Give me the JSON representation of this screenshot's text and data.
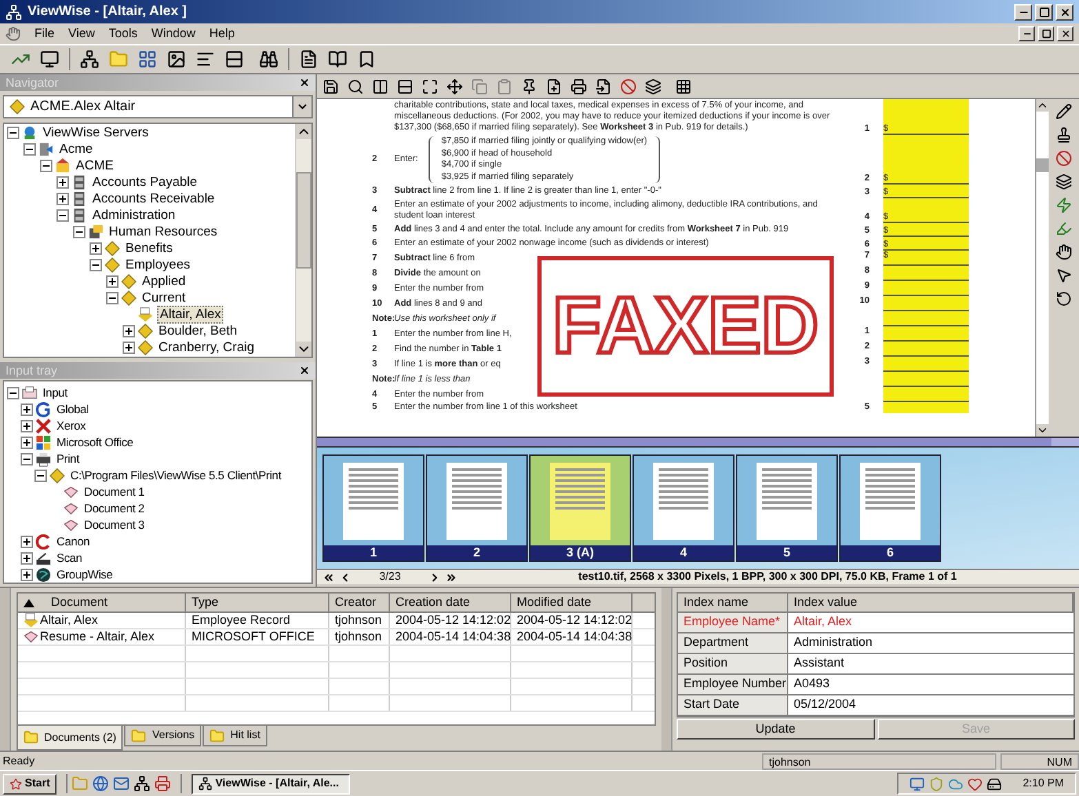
{
  "window": {
    "title": "ViewWise - [Altair, Alex ]"
  },
  "menu": [
    "File",
    "View",
    "Tools",
    "Window",
    "Help"
  ],
  "navigator": {
    "title": "Navigator",
    "selector": "ACME.Alex Altair",
    "tree": [
      {
        "label": "ViewWise Servers",
        "kind": "servers",
        "expanded": true,
        "selected": false,
        "children": [
          {
            "label": "Acme",
            "kind": "server",
            "expanded": true,
            "selected": false,
            "children": [
              {
                "label": "ACME",
                "kind": "site",
                "expanded": true,
                "selected": false,
                "children": [
                  {
                    "label": "Accounts Payable",
                    "kind": "cabinet",
                    "expanded": false,
                    "selected": false
                  },
                  {
                    "label": "Accounts Receivable",
                    "kind": "cabinet",
                    "expanded": false,
                    "selected": false
                  },
                  {
                    "label": "Administration",
                    "kind": "cabinet",
                    "expanded": true,
                    "selected": false,
                    "children": [
                      {
                        "label": "Human Resources",
                        "kind": "drawer",
                        "expanded": true,
                        "selected": false,
                        "children": [
                          {
                            "label": "Benefits",
                            "kind": "diamond",
                            "expanded": false,
                            "selected": false
                          },
                          {
                            "label": "Employees",
                            "kind": "diamond",
                            "expanded": true,
                            "selected": false,
                            "children": [
                              {
                                "label": "Applied",
                                "kind": "diamond",
                                "expanded": false,
                                "selected": false
                              },
                              {
                                "label": "Current",
                                "kind": "diamond",
                                "expanded": true,
                                "selected": false,
                                "children": [
                                  {
                                    "label": "Altair, Alex",
                                    "kind": "record",
                                    "selected": true
                                  },
                                  {
                                    "label": "Boulder, Beth",
                                    "kind": "diamond",
                                    "expanded": false,
                                    "selected": false
                                  },
                                  {
                                    "label": "Cranberry, Craig",
                                    "kind": "diamond",
                                    "expanded": false,
                                    "selected": false
                                  }
                                ]
                              }
                            ]
                          }
                        ]
                      }
                    ]
                  }
                ]
              }
            ]
          }
        ]
      }
    ]
  },
  "input_tray": {
    "title": "Input tray",
    "tree": [
      {
        "label": "Input",
        "kind": "tray",
        "expanded": true,
        "selected": false,
        "children": [
          {
            "label": "Global",
            "kind": "global",
            "expanded": false,
            "selected": false
          },
          {
            "label": "Xerox",
            "kind": "xerox",
            "expanded": false,
            "selected": false
          },
          {
            "label": "Microsoft Office",
            "kind": "office",
            "expanded": false,
            "selected": false
          },
          {
            "label": "Print",
            "kind": "printer",
            "expanded": true,
            "selected": false,
            "children": [
              {
                "label": "C:\\Program Files\\ViewWise 5.5 Client\\Print",
                "kind": "diamond",
                "expanded": true,
                "selected": false,
                "children": [
                  {
                    "label": "Document 1",
                    "kind": "document",
                    "selected": false
                  },
                  {
                    "label": "Document 2",
                    "kind": "document",
                    "selected": false
                  },
                  {
                    "label": "Document 3",
                    "kind": "document",
                    "selected": false
                  }
                ]
              }
            ]
          },
          {
            "label": "Canon",
            "kind": "canon",
            "expanded": false,
            "selected": false
          },
          {
            "label": "Scan",
            "kind": "scanner",
            "expanded": false,
            "selected": false
          },
          {
            "label": "GroupWise",
            "kind": "groupwise",
            "expanded": false,
            "selected": false
          }
        ]
      }
    ]
  },
  "form": {
    "lines": [
      {
        "kind": "text",
        "text": "charitable contributions, state and local taxes, medical expenses in excess of 7.5% of your income, and miscellaneous deductions. (For 2002, you may have to reduce your itemized deductions if your income is over $137,300 ($68,650 if married filing separately). See **Worksheet 3** in Pub. 919 for details.)",
        "ref": "1",
        "amount": "$"
      },
      {
        "kind": "choice",
        "number": "2",
        "text": "Enter:",
        "options": [
          "$7,850 if married filing jointly or qualifying widow(er)",
          "$6,900 if head of household",
          "$4,700 if single",
          "$3,925 if married filing separately"
        ],
        "ref": "2",
        "amount": "$"
      },
      {
        "kind": "text",
        "number": "3",
        "text": "**Subtract** line 2 from line 1. If line 2 is greater than line 1, enter \"-0-\"",
        "ref": "3",
        "amount": "$"
      },
      {
        "kind": "text",
        "number": "4",
        "text": "Enter an estimate of your 2002 adjustments to income, including alimony, deductible IRA contributions, and student loan interest",
        "ref": "4",
        "amount": "$"
      },
      {
        "kind": "text",
        "number": "5",
        "text": "**Add** lines 3 and 4 and enter the total. Include any amount for credits from **Worksheet 7** in Pub. 919",
        "ref": "5",
        "amount": "$"
      },
      {
        "kind": "text",
        "number": "6",
        "text": "Enter an estimate of your 2002 nonwage income (such as dividends or interest)",
        "ref": "6",
        "amount": "$"
      }
    ],
    "stamp": {
      "text": "FAXED",
      "fragments": [
        {
          "number": "7",
          "text": "**Subtract** line 6 from",
          "ref": "7",
          "amount": "$"
        },
        {
          "number": "8",
          "text": "**Divide** the amount on",
          "ref": "8"
        },
        {
          "number": "9",
          "text": "Enter the number from",
          "ref": "9"
        },
        {
          "number": "10",
          "text": "**Add** lines 8 and 9 and",
          "ref": "10"
        },
        {
          "number": "Note:",
          "text": "*Use this worksheet only if*"
        },
        {
          "number": "1",
          "text": "Enter the number from line H,",
          "ref": "1"
        },
        {
          "number": "2",
          "text": "Find the number in **Table 1**",
          "ref": "2"
        },
        {
          "number": "3",
          "text": "If line 1 is **more than** or eq",
          "ref": "3"
        },
        {
          "number": "Note:",
          "text": "*If line 1 is less than*"
        },
        {
          "number": "4",
          "text": "Enter the number from"
        }
      ]
    },
    "footer": {
      "number": "5",
      "text": "Enter the number from line 1 of this worksheet",
      "ref": "5"
    }
  },
  "thumbnails": [
    {
      "label": "1",
      "selected": false
    },
    {
      "label": "2",
      "selected": false
    },
    {
      "label": "3 (A)",
      "selected": true
    },
    {
      "label": "4",
      "selected": false
    },
    {
      "label": "5",
      "selected": false
    },
    {
      "label": "6",
      "selected": false
    }
  ],
  "page_nav": {
    "position": "3/23",
    "file_info": "test10.tif, 2568 x 3300 Pixels, 1 BPP, 300 x 300 DPI, 75.0 KB, Frame 1 of 1"
  },
  "documents_table": {
    "columns": [
      {
        "label": "Document",
        "sorted": true
      },
      {
        "label": "Type",
        "sorted": false
      },
      {
        "label": "Creator",
        "sorted": false
      },
      {
        "label": "Creation date",
        "sorted": false
      },
      {
        "label": "Modified date",
        "sorted": false
      }
    ],
    "rows": [
      {
        "kind": "record",
        "cells": [
          "Altair, Alex",
          "Employee Record",
          "tjohnson",
          "2004-05-12 14:12:02",
          "2004-05-12 14:12:02"
        ]
      },
      {
        "kind": "document",
        "cells": [
          "Resume - Altair, Alex",
          "MICROSOFT OFFICE",
          "tjohnson",
          "2004-05-14 14:04:38",
          "2004-05-14 14:04:38"
        ]
      }
    ]
  },
  "bottom_tabs": [
    {
      "label": "Documents (2)",
      "selected": true
    },
    {
      "label": "Versions",
      "selected": false
    },
    {
      "label": "Hit list",
      "selected": false
    }
  ],
  "index_table": {
    "columns": [
      "Index name",
      "Index value"
    ],
    "rows": [
      {
        "name": "Employee Name*",
        "value": "Altair, Alex",
        "flagged": true
      },
      {
        "name": "Department",
        "value": "Administration",
        "flagged": false
      },
      {
        "name": "Position",
        "value": "Assistant",
        "flagged": false
      },
      {
        "name": "Employee Number",
        "value": "A0493",
        "flagged": false
      },
      {
        "name": "Start Date",
        "value": "05/12/2004",
        "flagged": false
      }
    ]
  },
  "buttons": [
    {
      "label": "Update",
      "disabled": false
    },
    {
      "label": "Save",
      "disabled": true
    }
  ],
  "status_bar": {
    "message": "Ready",
    "user": "tjohnson",
    "indicator": "NUM"
  },
  "taskbar": {
    "start": "Start",
    "task": "ViewWise - [Altair, Ale...",
    "clock": "2:10 PM"
  }
}
